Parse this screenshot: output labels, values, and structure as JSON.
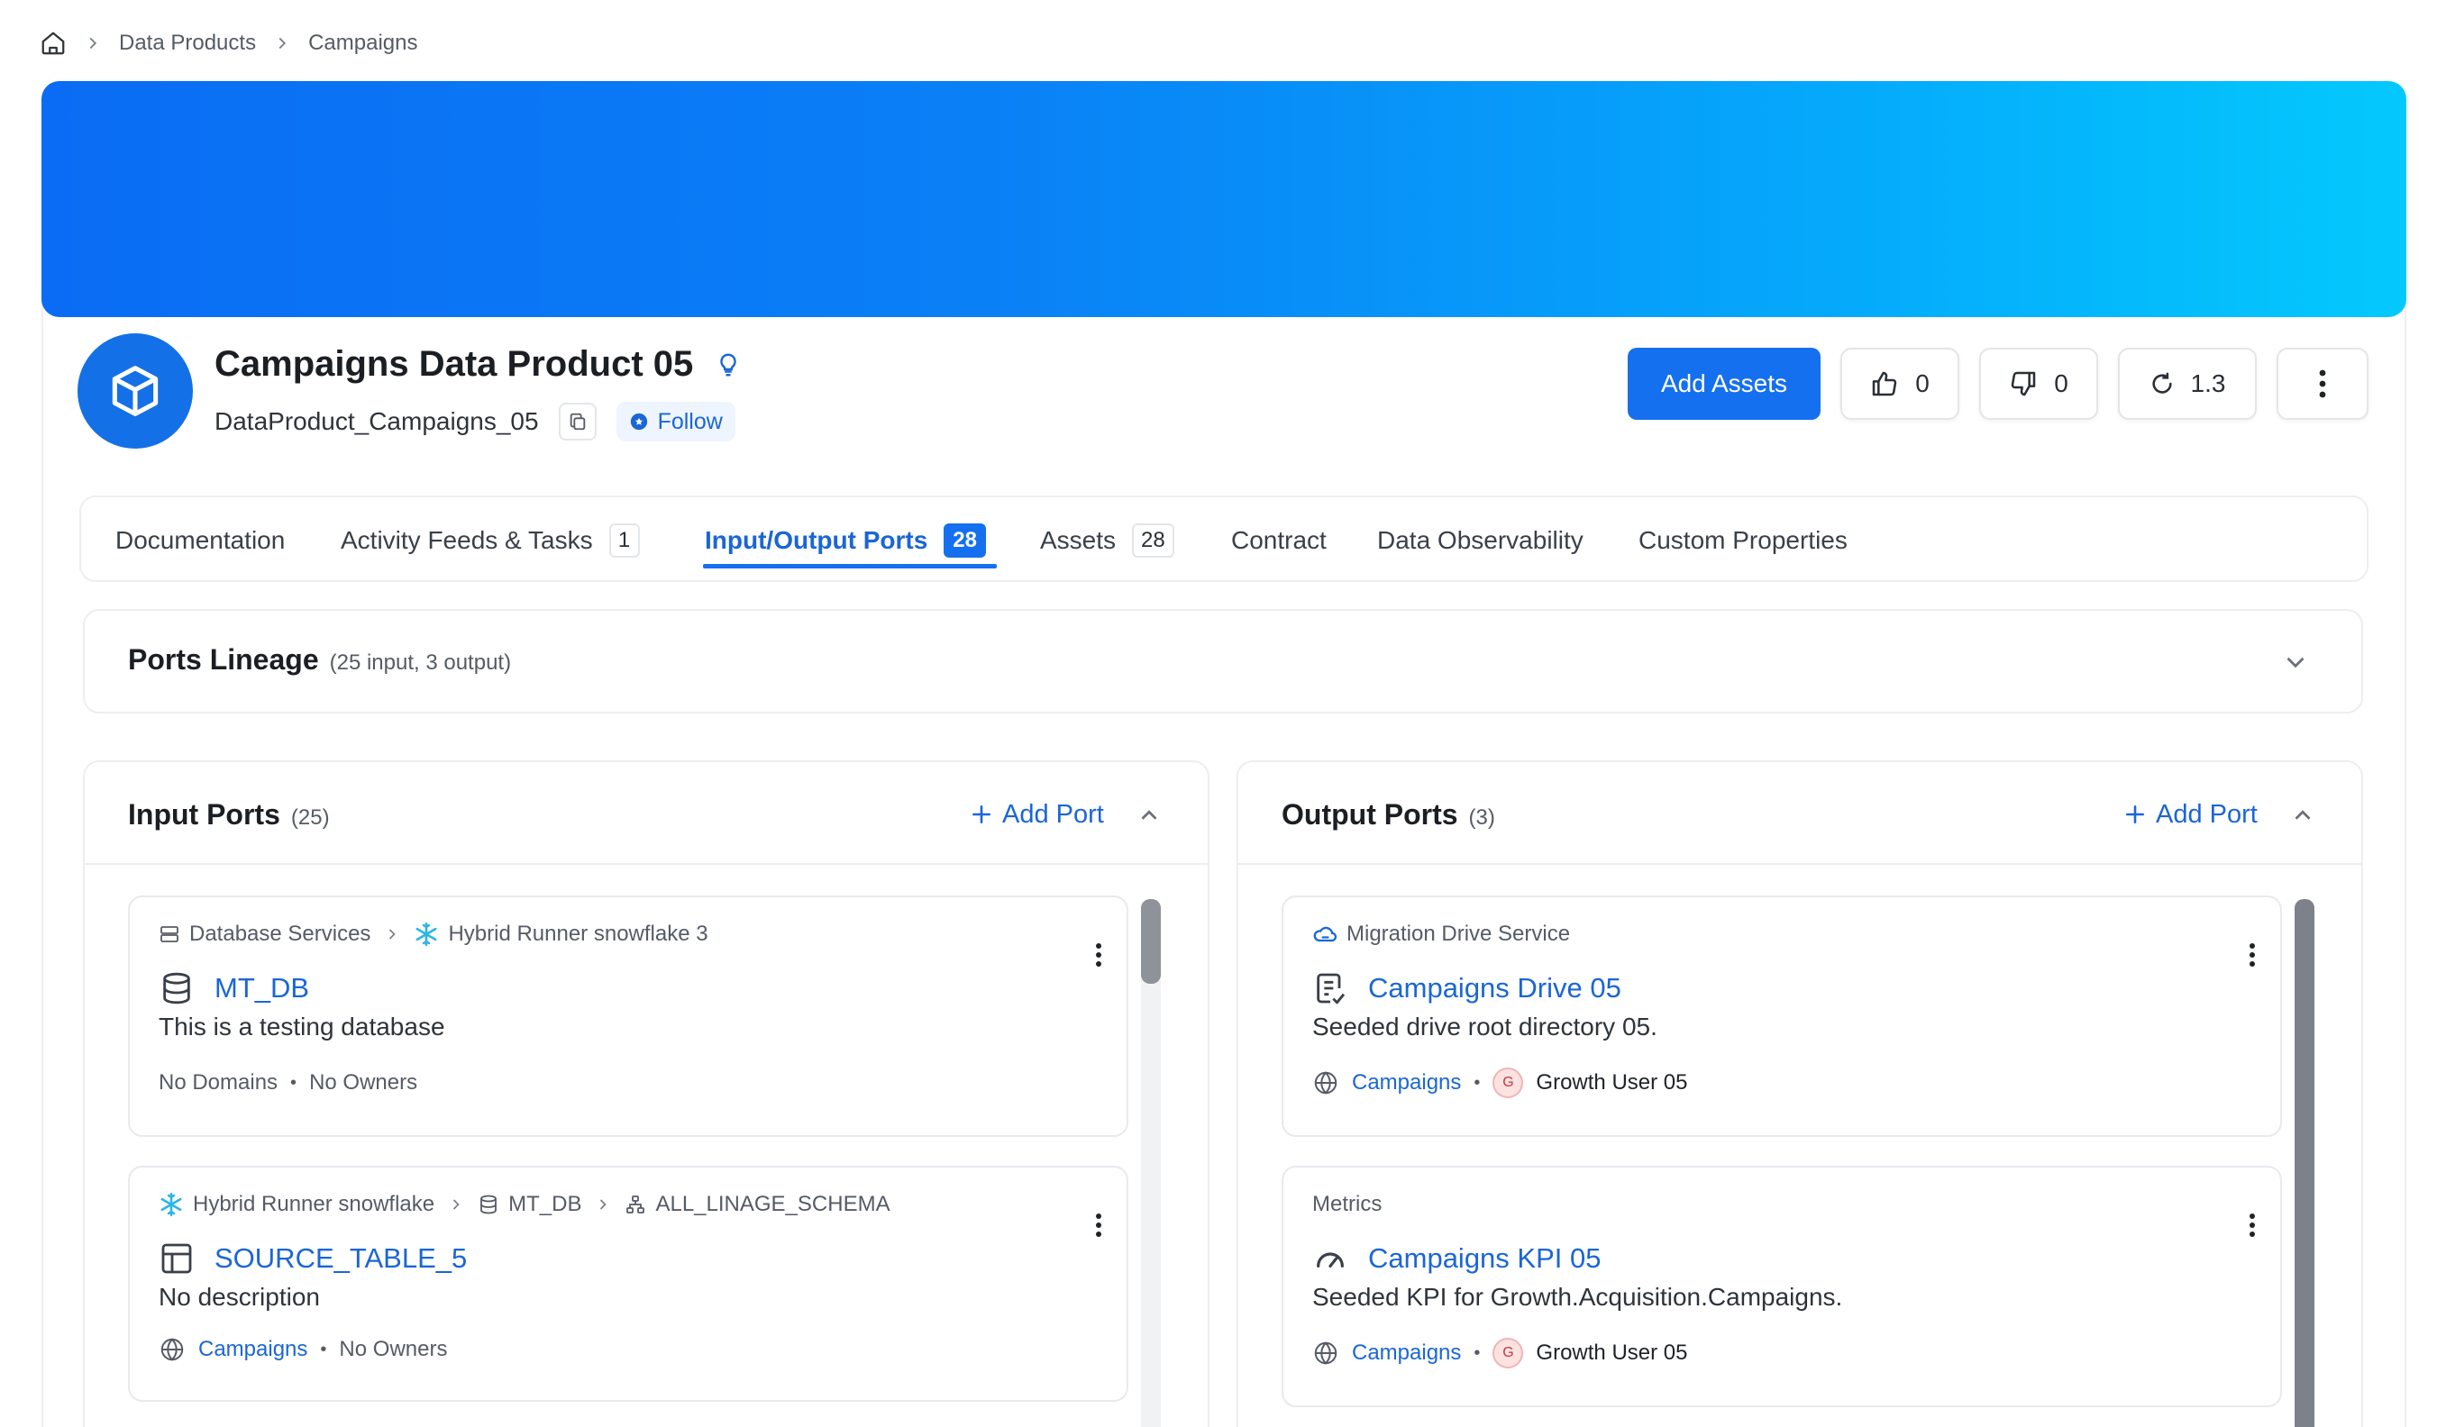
{
  "breadcrumb": {
    "items": [
      "Data Products",
      "Campaigns"
    ]
  },
  "header": {
    "title": "Campaigns Data Product 05",
    "fqn": "DataProduct_Campaigns_05",
    "follow_label": "Follow",
    "add_assets_label": "Add Assets",
    "upvotes": "0",
    "downvotes": "0",
    "version": "1.3"
  },
  "tabs": [
    {
      "label": "Documentation"
    },
    {
      "label": "Activity Feeds & Tasks",
      "count": "1"
    },
    {
      "label": "Input/Output Ports",
      "count": "28",
      "active": true
    },
    {
      "label": "Assets",
      "count": "28"
    },
    {
      "label": "Contract"
    },
    {
      "label": "Data Observability"
    },
    {
      "label": "Custom Properties"
    }
  ],
  "lineage": {
    "title": "Ports Lineage",
    "summary": "(25 input, 3 output)"
  },
  "input_ports": {
    "title": "Input Ports",
    "count": "(25)",
    "add_label": "Add Port",
    "cards": [
      {
        "crumbs": [
          "Database Services",
          "Hybrid Runner snowflake 3"
        ],
        "name": "MT_DB",
        "description": "This is a testing database",
        "domain": "No Domains",
        "owner": "No Owners"
      },
      {
        "crumbs": [
          "Hybrid Runner snowflake",
          "MT_DB",
          "ALL_LINAGE_SCHEMA"
        ],
        "name": "SOURCE_TABLE_5",
        "description": "No description",
        "domain": "Campaigns",
        "owner": "No Owners"
      }
    ]
  },
  "output_ports": {
    "title": "Output Ports",
    "count": "(3)",
    "add_label": "Add Port",
    "cards": [
      {
        "crumbs": [
          "Migration Drive Service"
        ],
        "name": "Campaigns Drive 05",
        "description": "Seeded drive root directory 05.",
        "domain": "Campaigns",
        "owner_initial": "G",
        "owner": "Growth User 05"
      },
      {
        "crumbs": [
          "Metrics"
        ],
        "name": "Campaigns KPI 05",
        "description": "Seeded KPI for Growth.Acquisition.Campaigns.",
        "domain": "Campaigns",
        "owner_initial": "G",
        "owner": "Growth User 05"
      }
    ]
  },
  "colors": {
    "primary": "#1570ef",
    "link": "#1a66d6",
    "border": "#eceef1",
    "banner_start": "#0a6cf4",
    "banner_end": "#04c9fd"
  }
}
